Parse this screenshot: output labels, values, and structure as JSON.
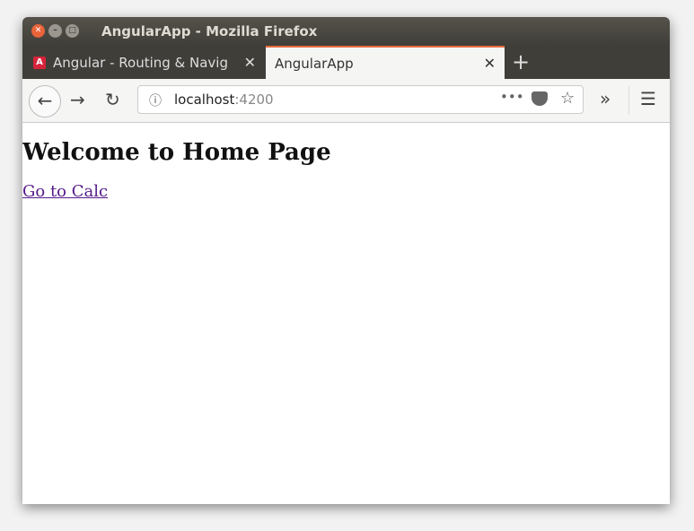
{
  "window": {
    "title": "AngularApp - Mozilla Firefox"
  },
  "tabs": [
    {
      "label": "Angular - Routing & Navig",
      "favicon": "A"
    },
    {
      "label": "AngularApp"
    }
  ],
  "address": {
    "host": "localhost",
    "port": ":4200"
  },
  "page": {
    "heading": "Welcome to Home Page",
    "link": "Go to Calc"
  },
  "colors": {
    "accent": "#e66c3d",
    "link": "#551a8b"
  }
}
